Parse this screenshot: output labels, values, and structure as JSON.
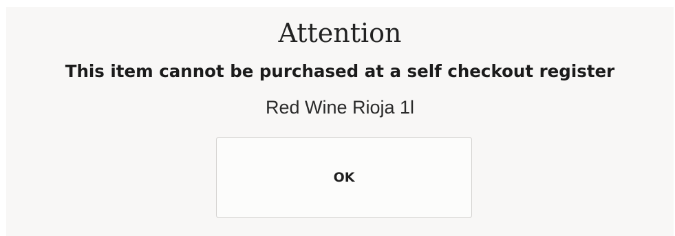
{
  "dialog": {
    "title": "Attention",
    "message": "This item cannot be purchased at a self checkout register",
    "item_name": "Red Wine Rioja 1l",
    "ok_label": "OK"
  }
}
